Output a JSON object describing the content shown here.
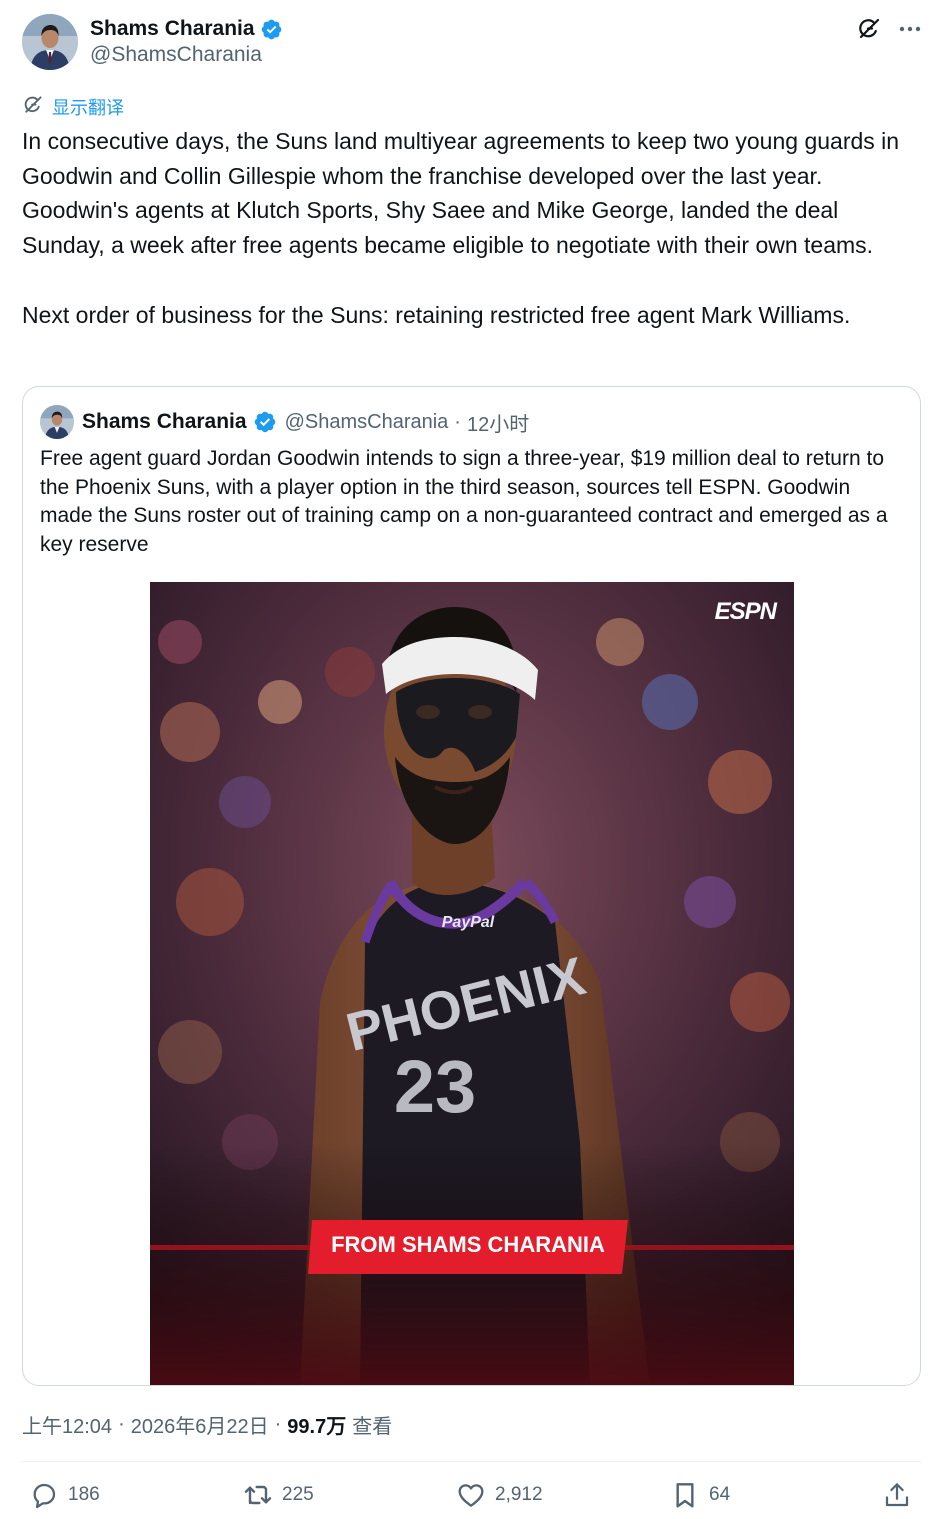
{
  "author": {
    "name": "Shams Charania",
    "handle": "@ShamsCharania"
  },
  "translate_label": "显示翻译",
  "tweet_text": "In consecutive days, the Suns land multiyear agreements to keep two young guards in Goodwin and Collin Gillespie whom the franchise developed over the last year. Goodwin's agents at Klutch Sports, Shy Saee and Mike George, landed the deal Sunday, a week after free agents became eligible to negotiate with their own teams.\n\nNext order of business for the Suns: retaining restricted free agent Mark Williams.",
  "quote": {
    "name": "Shams Charania",
    "handle": "@ShamsCharania",
    "dot": "·",
    "time": "12小时",
    "text": "Free agent guard Jordan Goodwin intends to sign a three-year, $19 million deal to return to the Phoenix Suns, with a player option in the third season, sources tell ESPN. Goodwin made the Suns roster out of training camp on a non-guaranteed contract and emerged as a key reserve",
    "media": {
      "espn_logo": "ESPN",
      "jersey_team": "PHOENIX",
      "jersey_number": "23",
      "jersey_sponsor": "PayPal",
      "banner": "FROM SHAMS CHARANIA"
    }
  },
  "meta": {
    "time": "上午12:04",
    "sep1": "·",
    "date": "2026年6月22日",
    "sep2": "·",
    "views": "99.7万",
    "views_label": "查看"
  },
  "actions": {
    "replies": "186",
    "reposts": "225",
    "likes": "2,912",
    "bookmarks": "64"
  },
  "colors": {
    "link": "#1d9bf0",
    "secondary_text": "#536471",
    "border": "#cfd9de",
    "banner_red": "#e31d2b"
  },
  "icons": [
    "verified-badge-icon",
    "grok-icon",
    "more-icon",
    "translate-icon",
    "reply-icon",
    "repost-icon",
    "like-icon",
    "bookmark-icon",
    "share-icon"
  ]
}
